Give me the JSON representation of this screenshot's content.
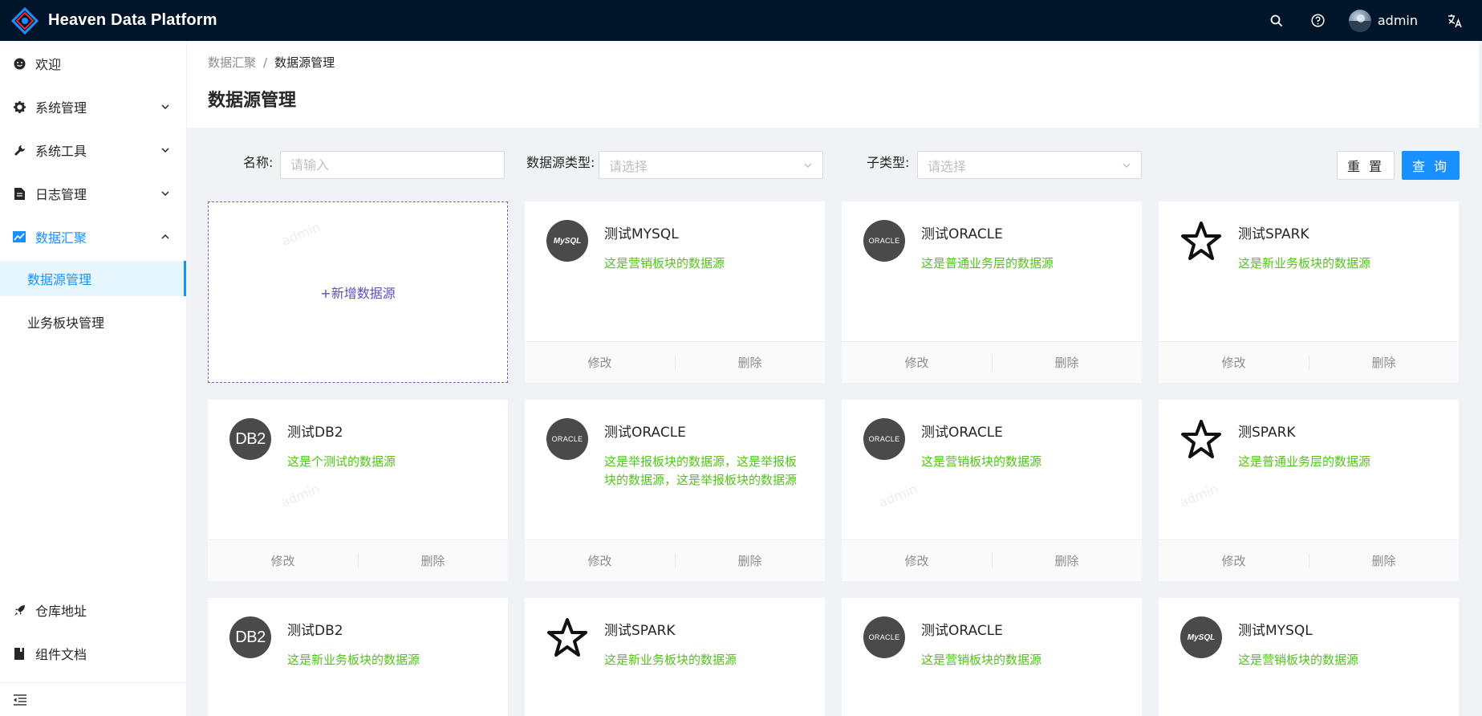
{
  "app": {
    "title": "Heaven Data Platform",
    "user": "admin"
  },
  "sidebar": {
    "items": [
      {
        "label": "欢迎",
        "icon": "smile-icon"
      },
      {
        "label": "系统管理",
        "icon": "gear-icon"
      },
      {
        "label": "系统工具",
        "icon": "wrench-icon"
      },
      {
        "label": "日志管理",
        "icon": "file-icon"
      },
      {
        "label": "数据汇聚",
        "icon": "chart-icon"
      }
    ],
    "sub_items": [
      {
        "label": "数据源管理"
      },
      {
        "label": "业务板块管理"
      }
    ],
    "bottom_items": [
      {
        "label": "仓库地址",
        "icon": "rocket-icon"
      },
      {
        "label": "组件文档",
        "icon": "book-icon"
      }
    ]
  },
  "breadcrumb": {
    "parent": "数据汇聚",
    "separator": "/",
    "current": "数据源管理"
  },
  "page_title": "数据源管理",
  "filters": {
    "name_label": "名称:",
    "name_placeholder": "请输入",
    "type_label": "数据源类型:",
    "type_placeholder": "请选择",
    "subtype_label": "子类型:",
    "subtype_placeholder": "请选择",
    "reset_label": "重 置",
    "query_label": "查 询"
  },
  "add_card_label": "+新增数据源",
  "watermark_text": "admin",
  "card_actions": {
    "edit": "修改",
    "delete": "删除"
  },
  "cards": [
    {
      "title": "测试MYSQL",
      "desc": "这是营销板块的数据源",
      "logo": "MySQL"
    },
    {
      "title": "测试ORACLE",
      "desc": "这是普通业务层的数据源",
      "logo": "ORACLE"
    },
    {
      "title": "测试SPARK",
      "desc": "这是新业务板块的数据源",
      "logo": "spark-star-icon"
    },
    {
      "title": "测试DB2",
      "desc": "这是个测试的数据源",
      "logo": "DB2"
    },
    {
      "title": "测试ORACLE",
      "desc": "这是举报板块的数据源，这是举报板块的数据源，这是举报板块的数据源",
      "logo": "ORACLE"
    },
    {
      "title": "测试ORACLE",
      "desc": "这是营销板块的数据源",
      "logo": "ORACLE"
    },
    {
      "title": "测SPARK",
      "desc": "这是普通业务层的数据源",
      "logo": "spark-star-icon"
    },
    {
      "title": "测试DB2",
      "desc": "这是新业务板块的数据源",
      "logo": "DB2"
    },
    {
      "title": "测试SPARK",
      "desc": "这是新业务板块的数据源",
      "logo": "spark-star-icon"
    },
    {
      "title": "测试ORACLE",
      "desc": "这是营销板块的数据源",
      "logo": "ORACLE"
    },
    {
      "title": "测试MYSQL",
      "desc": "这是营销板块的数据源",
      "logo": "MySQL"
    }
  ],
  "colors": {
    "header_bg": "#001529",
    "primary": "#1890ff",
    "desc_green": "#52c41a",
    "add_border": "#6b5fc7"
  }
}
